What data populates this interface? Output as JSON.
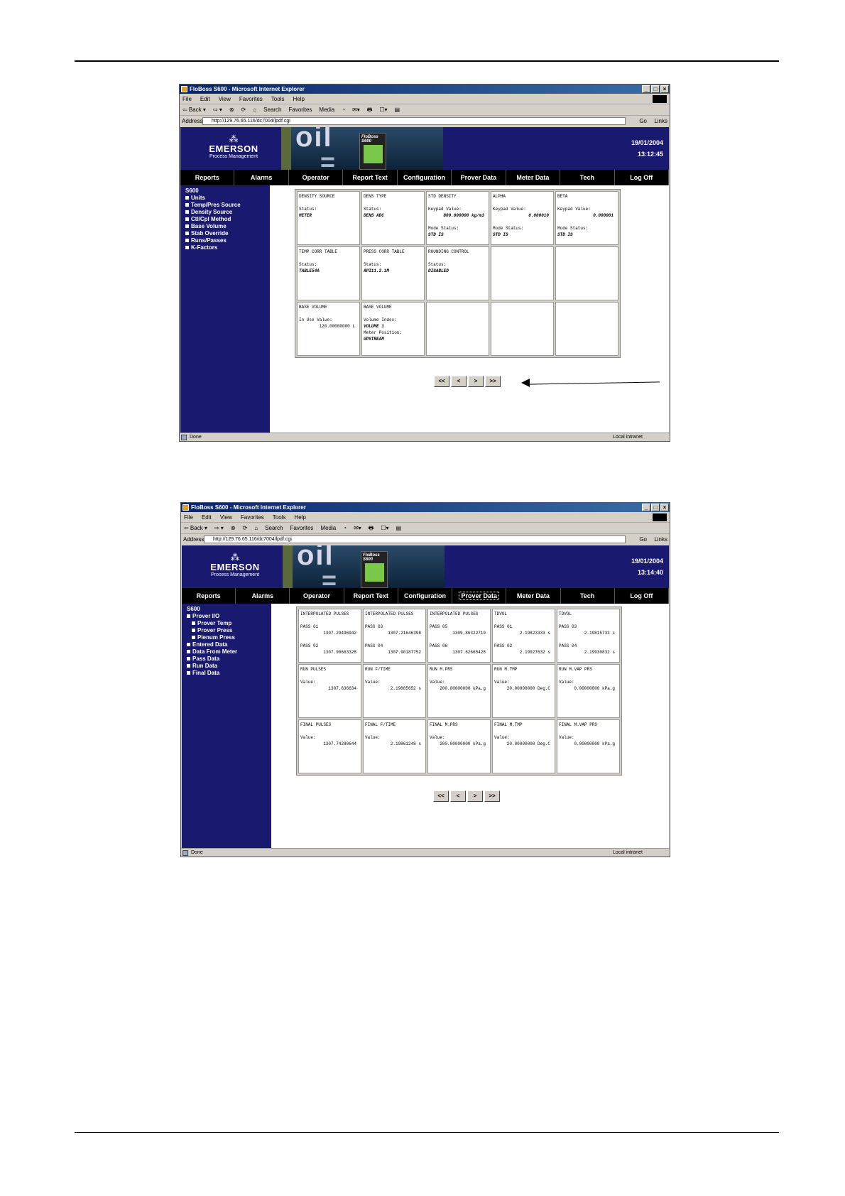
{
  "browser": {
    "title": "FloBoss S600 - Microsoft Internet Explorer",
    "menu": [
      "File",
      "Edit",
      "View",
      "Favorites",
      "Tools",
      "Help"
    ],
    "toolbar": [
      "⇦ Back ▾",
      "⇨ ▾",
      "⊗",
      "⟳",
      "⌂",
      "Search",
      "Favorites",
      "Media",
      "◔",
      "✉▾",
      "🖶",
      "☐▾",
      "▤"
    ],
    "address_label": "Address",
    "go_label": "Go",
    "links_label": "Links",
    "status_done": "Done",
    "status_zone": "Local intranet"
  },
  "app": {
    "logo_mark": "⁂",
    "logo_name": "EMERSON",
    "logo_sub": "Process Management",
    "banner_device_label": "FloBoss S600",
    "nav": [
      "Reports",
      "Alarms",
      "Operator",
      "Report Text",
      "Configuration",
      "Prover Data",
      "Meter Data",
      "Tech",
      "Log Off"
    ]
  },
  "screen1": {
    "url": "http://129.76.65.116/dc7004/lpdf.cgi",
    "date": "19/01/2004",
    "time": "13:12:45",
    "sidebar": [
      {
        "label": "S600",
        "bullet": false
      },
      {
        "label": "Units",
        "bullet": true
      },
      {
        "label": "Temp/Pres Source",
        "bullet": true
      },
      {
        "label": "Density Source",
        "bullet": true
      },
      {
        "label": "Ctl/Cpl Method",
        "bullet": true
      },
      {
        "label": "Base Volume",
        "bullet": true
      },
      {
        "label": "Stab Override",
        "bullet": true
      },
      {
        "label": "Runs/Passes",
        "bullet": true
      },
      {
        "label": "K-Factors",
        "bullet": true
      }
    ],
    "cells": [
      [
        {
          "title": "DENSITY SOURCE",
          "lines": [
            {
              "t": "gap"
            },
            {
              "t": "lab",
              "v": "Status:"
            },
            {
              "t": "val",
              "v": "METER"
            }
          ]
        },
        {
          "title": "DENS TYPE",
          "lines": [
            {
              "t": "gap"
            },
            {
              "t": "lab",
              "v": "Status:"
            },
            {
              "t": "val",
              "v": "DENS ADC"
            }
          ]
        },
        {
          "title": "STD DENSITY",
          "lines": [
            {
              "t": "gap"
            },
            {
              "t": "lab",
              "v": "Keypad Value:"
            },
            {
              "t": "valr",
              "v": "800.000000 kg/m3"
            },
            {
              "t": "gap"
            },
            {
              "t": "lab",
              "v": "Mode Status:"
            },
            {
              "t": "val",
              "v": "STD IS"
            }
          ]
        },
        {
          "title": "ALPHA",
          "lines": [
            {
              "t": "gap"
            },
            {
              "t": "lab",
              "v": "Keypad Value:"
            },
            {
              "t": "valr",
              "v": "0.000010"
            },
            {
              "t": "gap"
            },
            {
              "t": "lab",
              "v": "Mode Status:"
            },
            {
              "t": "val",
              "v": "STD IS"
            }
          ]
        },
        {
          "title": "BETA",
          "lines": [
            {
              "t": "gap"
            },
            {
              "t": "lab",
              "v": "Keypad Value:"
            },
            {
              "t": "valr",
              "v": "0.000001"
            },
            {
              "t": "gap"
            },
            {
              "t": "lab",
              "v": "Mode Status:"
            },
            {
              "t": "val",
              "v": "STD IS"
            }
          ]
        }
      ],
      [
        {
          "title": "TEMP CORR TABLE",
          "lines": [
            {
              "t": "gap"
            },
            {
              "t": "lab",
              "v": "Status:"
            },
            {
              "t": "val",
              "v": "TABLE54A"
            }
          ]
        },
        {
          "title": "PRESS CORR TABLE",
          "lines": [
            {
              "t": "gap"
            },
            {
              "t": "lab",
              "v": "Status:"
            },
            {
              "t": "val",
              "v": "API11.2.1M"
            }
          ]
        },
        {
          "title": "ROUNDING CONTROL",
          "lines": [
            {
              "t": "gap"
            },
            {
              "t": "lab",
              "v": "Status:"
            },
            {
              "t": "val",
              "v": "DISABLED"
            }
          ]
        },
        {
          "title": "",
          "lines": []
        },
        {
          "title": "",
          "lines": []
        }
      ],
      [
        {
          "title": "BASE VOLUME",
          "lines": [
            {
              "t": "gap"
            },
            {
              "t": "lab",
              "v": "In Use Value:"
            },
            {
              "t": "num",
              "v": "120.00000000 L"
            }
          ]
        },
        {
          "title": "BASE VOLUME",
          "lines": [
            {
              "t": "gap"
            },
            {
              "t": "lab",
              "v": "Volume Index:"
            },
            {
              "t": "val",
              "v": "VOLUME 1"
            },
            {
              "t": "lab",
              "v": "Meter Position:"
            },
            {
              "t": "val",
              "v": "UPSTREAM"
            }
          ]
        },
        {
          "title": "",
          "lines": []
        },
        {
          "title": "",
          "lines": []
        },
        {
          "title": "",
          "lines": []
        }
      ]
    ]
  },
  "screen2": {
    "url": "http://129.76.65.116/dc7004/lpdf.cgi",
    "date": "19/01/2004",
    "time": "13:14:40",
    "active_nav": "Prover Data",
    "sidebar": [
      {
        "label": "S600",
        "bullet": false,
        "sub": false
      },
      {
        "label": "Prover I/O",
        "bullet": true,
        "sub": false
      },
      {
        "label": "Prover Temp",
        "bullet": true,
        "sub": true
      },
      {
        "label": "Prover Press",
        "bullet": true,
        "sub": true
      },
      {
        "label": "Plenum Press",
        "bullet": true,
        "sub": true
      },
      {
        "label": "Entered Data",
        "bullet": true,
        "sub": false
      },
      {
        "label": "Data From Meter",
        "bullet": true,
        "sub": false
      },
      {
        "label": "Pass Data",
        "bullet": true,
        "sub": false
      },
      {
        "label": "Run Data",
        "bullet": true,
        "sub": false
      },
      {
        "label": "Final Data",
        "bullet": true,
        "sub": false
      }
    ],
    "cells": [
      [
        {
          "title": "INTERPOLATED PULSES",
          "lines": [
            {
              "t": "gap"
            },
            {
              "t": "lab",
              "v": "PASS 01"
            },
            {
              "t": "num",
              "v": "1307.29496942"
            },
            {
              "t": "gap"
            },
            {
              "t": "lab",
              "v": "PASS 02"
            },
            {
              "t": "num",
              "v": "1307.90663328"
            }
          ]
        },
        {
          "title": "INTERPOLATED PULSES",
          "lines": [
            {
              "t": "gap"
            },
            {
              "t": "lab",
              "v": "PASS 03"
            },
            {
              "t": "num",
              "v": "1307.21646398"
            },
            {
              "t": "gap"
            },
            {
              "t": "lab",
              "v": "PASS 04"
            },
            {
              "t": "num",
              "v": "1307.90187752"
            }
          ]
        },
        {
          "title": "INTERPOLATED PULSES",
          "lines": [
            {
              "t": "gap"
            },
            {
              "t": "lab",
              "v": "PASS 05"
            },
            {
              "t": "num",
              "v": "1309.86322719"
            },
            {
              "t": "gap"
            },
            {
              "t": "lab",
              "v": "PASS 06"
            },
            {
              "t": "num",
              "v": "1307.62665428"
            }
          ]
        },
        {
          "title": "TDVOL",
          "lines": [
            {
              "t": "gap"
            },
            {
              "t": "lab",
              "v": "PASS 01"
            },
            {
              "t": "num",
              "v": "2.19823333 s"
            },
            {
              "t": "gap"
            },
            {
              "t": "lab",
              "v": "PASS 02"
            },
            {
              "t": "num",
              "v": "2.19927632 s"
            }
          ]
        },
        {
          "title": "TDVOL",
          "lines": [
            {
              "t": "gap"
            },
            {
              "t": "lab",
              "v": "PASS 03"
            },
            {
              "t": "num",
              "v": "2.19815733 s"
            },
            {
              "t": "gap"
            },
            {
              "t": "lab",
              "v": "PASS 04"
            },
            {
              "t": "num",
              "v": "2.19930832 s"
            }
          ]
        }
      ],
      [
        {
          "title": "RUN PULSES",
          "lines": [
            {
              "t": "gap"
            },
            {
              "t": "lab",
              "v": "Value:"
            },
            {
              "t": "num",
              "v": "1307.636634"
            }
          ]
        },
        {
          "title": "RUN F/TIME",
          "lines": [
            {
              "t": "gap"
            },
            {
              "t": "lab",
              "v": "Value:"
            },
            {
              "t": "num",
              "v": "2.19885652 s"
            }
          ]
        },
        {
          "title": "RUN M.PRS",
          "lines": [
            {
              "t": "gap"
            },
            {
              "t": "lab",
              "v": "Value:"
            },
            {
              "t": "num",
              "v": "200.00000000 kPa.g"
            }
          ]
        },
        {
          "title": "RUN M.TMP",
          "lines": [
            {
              "t": "gap"
            },
            {
              "t": "lab",
              "v": "Value:"
            },
            {
              "t": "num",
              "v": "20.00000000 Deg.C"
            }
          ]
        },
        {
          "title": "RUN M.VAP PRS",
          "lines": [
            {
              "t": "gap"
            },
            {
              "t": "lab",
              "v": "Value:"
            },
            {
              "t": "num",
              "v": "0.00000000 kPa.g"
            }
          ]
        }
      ],
      [
        {
          "title": "FINAL PULSES",
          "lines": [
            {
              "t": "gap"
            },
            {
              "t": "lab",
              "v": "Value:"
            },
            {
              "t": "num",
              "v": "1307.74280644"
            }
          ]
        },
        {
          "title": "FINAL F/TIME",
          "lines": [
            {
              "t": "gap"
            },
            {
              "t": "lab",
              "v": "Value:"
            },
            {
              "t": "num",
              "v": "2.19861248 s"
            }
          ]
        },
        {
          "title": "FINAL M.PRS",
          "lines": [
            {
              "t": "gap"
            },
            {
              "t": "lab",
              "v": "Value:"
            },
            {
              "t": "num",
              "v": "200.00000000 kPa.g"
            }
          ]
        },
        {
          "title": "FINAL M.TMP",
          "lines": [
            {
              "t": "gap"
            },
            {
              "t": "lab",
              "v": "Value:"
            },
            {
              "t": "num",
              "v": "20.00000000 Deg.C"
            }
          ]
        },
        {
          "title": "FINAL M.VAP PRS",
          "lines": [
            {
              "t": "gap"
            },
            {
              "t": "lab",
              "v": "Value:"
            },
            {
              "t": "num",
              "v": "0.00000000 kPa.g"
            }
          ]
        }
      ]
    ]
  },
  "pager": [
    "<<",
    "<",
    ">",
    ">>"
  ]
}
